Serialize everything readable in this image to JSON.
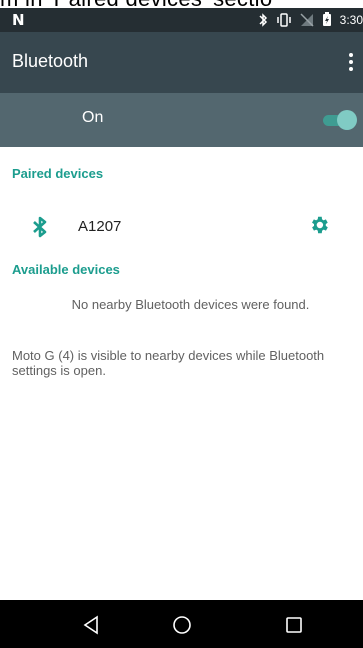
{
  "overlay_caption": "m in 'Paired devices' sectio",
  "status_bar": {
    "time": "3:30",
    "icons": [
      "n-logo-icon",
      "bluetooth-icon",
      "vibrate-icon",
      "no-signal-icon",
      "battery-icon"
    ]
  },
  "app_bar": {
    "title": "Bluetooth"
  },
  "toggle_bar": {
    "label": "On",
    "state": true
  },
  "paired": {
    "title": "Paired devices",
    "devices": [
      {
        "name": "A1207"
      }
    ]
  },
  "available": {
    "title": "Available devices",
    "empty_message": "No nearby Bluetooth devices were found."
  },
  "visibility_message": "Moto G (4) is visible to nearby devices while Bluetooth settings is open.",
  "colors": {
    "accent": "#1c9d8e",
    "app_bar": "#37474f",
    "toggle_bar": "#53676f",
    "status_bar": "#252e33"
  }
}
